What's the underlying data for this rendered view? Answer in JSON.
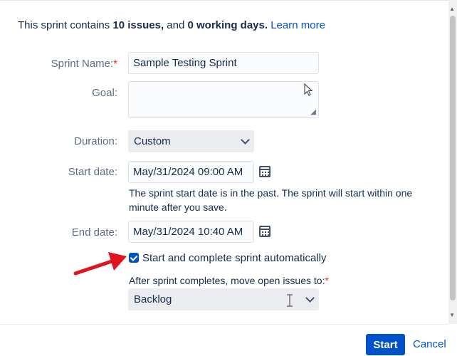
{
  "intro": {
    "prefix": "This sprint contains ",
    "issues": "10 issues,",
    "middle": " and ",
    "days": "0 working days.",
    "learn_more": "Learn more"
  },
  "form": {
    "sprint_name": {
      "label": "Sprint Name:",
      "required": "*",
      "value": "Sample Testing Sprint"
    },
    "goal": {
      "label": "Goal:",
      "value": ""
    },
    "duration": {
      "label": "Duration:",
      "value": "Custom"
    },
    "start_date": {
      "label": "Start date:",
      "value": "May/31/2024 09:00 AM",
      "help": "The sprint start date is in the past. The sprint will start within one minute after you save."
    },
    "end_date": {
      "label": "End date:",
      "value": "May/31/2024 10:40 AM"
    },
    "auto": {
      "label": "Start and complete sprint automatically",
      "checked": true
    },
    "move_issues": {
      "label": "After sprint completes, move open issues to:",
      "required": "*",
      "value": "Backlog"
    }
  },
  "footer": {
    "start": "Start",
    "cancel": "Cancel"
  },
  "colors": {
    "primary": "#0052cc",
    "required": "#de350b",
    "annotation_arrow": "#e0141e"
  },
  "icons": [
    "calendar-icon",
    "chevron-down-icon",
    "checkmark-icon",
    "resize-handle-icon",
    "mouse-pointer-icon",
    "text-cursor-icon"
  ]
}
